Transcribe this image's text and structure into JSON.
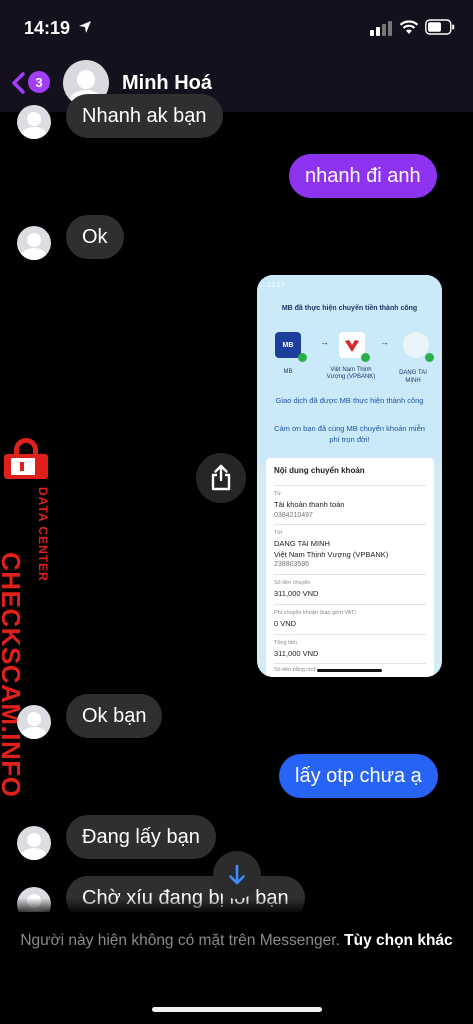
{
  "status_bar": {
    "time": "14:19",
    "icons": [
      "location-arrow-icon",
      "signal-icon",
      "wifi-icon",
      "battery-icon"
    ]
  },
  "header": {
    "unread_count": "3",
    "contact_name": "Minh Hoá"
  },
  "messages": [
    {
      "from": "them",
      "text": "Nhanh ak bạn"
    },
    {
      "from": "me",
      "text": "nhanh đi anh"
    },
    {
      "from": "them",
      "text": "Ok"
    },
    {
      "from": "me",
      "type": "image"
    },
    {
      "from": "them",
      "text": "Ok bạn"
    },
    {
      "from": "me",
      "text": "lấy otp chưa ạ"
    },
    {
      "from": "them",
      "text": "Đang lấy bạn"
    },
    {
      "from": "them",
      "text": "Chờ xíu đang bị lỗi bạn"
    }
  ],
  "screenshot": {
    "time": "13:17",
    "title": "MB đã thực hiện chuyển tiền thành công",
    "from_logo": "MB",
    "from_label": "MB",
    "bank_label": "Việt Nam Thịnh Vượng (VPBANK)",
    "to_label": "DANG TAI MINH",
    "message_1": "Giao dịch đã được MB thực hiện thành công",
    "message_2": "Cảm ơn bạn đã cùng MB chuyển khoản miễn phí trọn đời!",
    "section_title": "Nội dung chuyển khoản",
    "from_caption": "Từ",
    "from_account": "Tài khoản thanh toán",
    "from_number": "0384210497",
    "to_caption": "Tới",
    "to_name": "DANG TAI MINH",
    "to_bank": "Việt Nam Thịnh Vượng (VPBANK)",
    "to_number": "238803586",
    "amount_caption": "Số tiền chuyển",
    "amount": "311,000 VND",
    "fee_caption": "Phí chuyển khoản (bao gồm VAT)",
    "fee": "0 VND",
    "total_caption": "Tổng tiền",
    "total": "311,000 VND",
    "words_caption": "Số tiền bằng chữ"
  },
  "watermark": {
    "brand": "CHECKSCAM.INFO",
    "subtitle": "DATA CENTER"
  },
  "footer": {
    "notice": "Người này hiện không có mặt trên Messenger.",
    "link": "Tùy chọn khác"
  },
  "colors": {
    "outgoing": "#8e33f0",
    "outgoing_alt": "#2763f5",
    "incoming": "#2f2f31",
    "badge": "#a23ef7",
    "watermark": "#e0201b"
  }
}
